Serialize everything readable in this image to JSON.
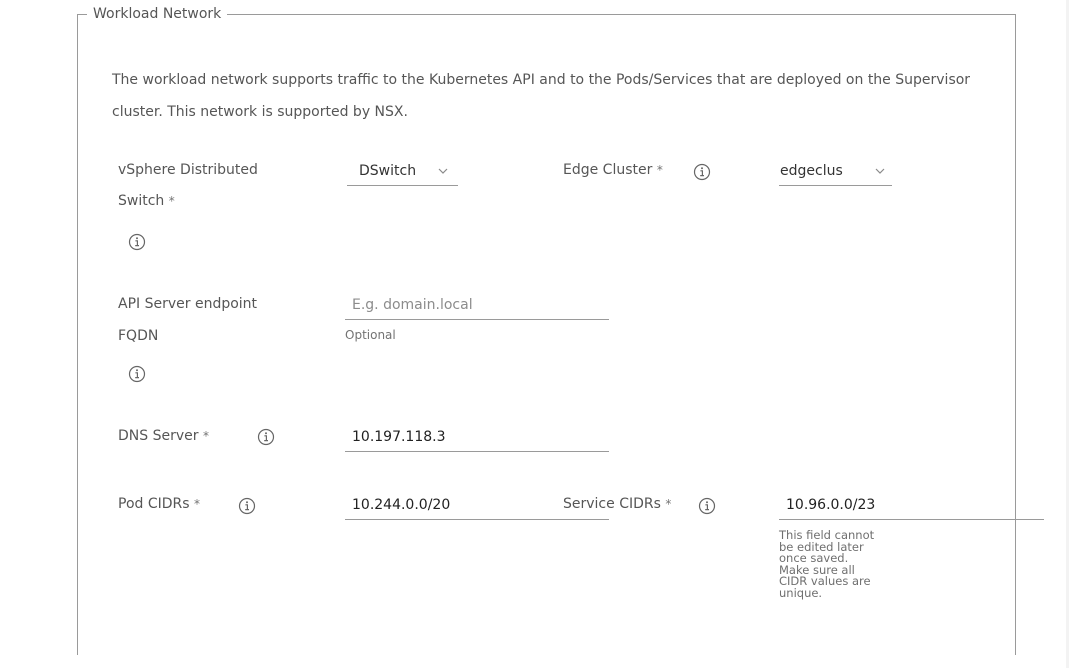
{
  "section": {
    "legend": "Workload Network",
    "description": "The workload network supports traffic to the Kubernetes API and to the Pods/Services that are deployed on the Supervisor cluster. This network is supported by NSX."
  },
  "fields": {
    "vds": {
      "label_line1": "vSphere Distributed",
      "label_line2": "Switch",
      "required": "*",
      "value": "DSwitch"
    },
    "edge_cluster": {
      "label": "Edge Cluster",
      "required": "*",
      "value": "edgeclus"
    },
    "api_fqdn": {
      "label_line1": "API Server endpoint",
      "label_line2": "FQDN",
      "placeholder": "E.g. domain.local",
      "helper": "Optional"
    },
    "dns": {
      "label": "DNS Server",
      "required": "*",
      "value": "10.197.118.3"
    },
    "pod_cidrs": {
      "label": "Pod CIDRs",
      "required": "*",
      "value": "10.244.0.0/20"
    },
    "service_cidrs": {
      "label": "Service CIDRs",
      "required": "*",
      "value": "10.96.0.0/23",
      "warning_lines": [
        "This field cannot",
        "be edited later",
        "once saved.",
        "Make sure all",
        "CIDR values are",
        "unique."
      ]
    }
  },
  "icons": {
    "info": "info-icon",
    "dropdown": "chevron-down-icon"
  },
  "colors": {
    "text": "#565656",
    "border": "#9a9a9a",
    "placeholder": "#8c8c8c"
  }
}
